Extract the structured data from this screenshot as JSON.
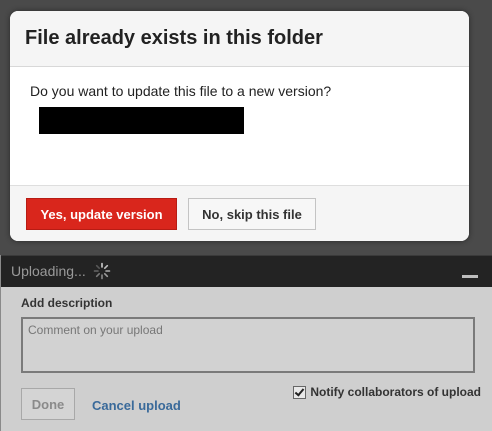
{
  "dialog": {
    "title": "File already exists in this folder",
    "question": "Do you want to update this file to a new version?",
    "yes_label": "Yes, update version",
    "skip_label": "No, skip this file",
    "accent_color": "#d9261c"
  },
  "upload": {
    "status": "Uploading...",
    "spinner_icon": "spinner-icon",
    "minimize_icon": "minimize-icon",
    "description_label": "Add description",
    "comment_placeholder": "Comment on your upload",
    "done_label": "Done",
    "cancel_label": "Cancel upload",
    "notify_label": "Notify collaborators of upload",
    "notify_checked": true
  }
}
